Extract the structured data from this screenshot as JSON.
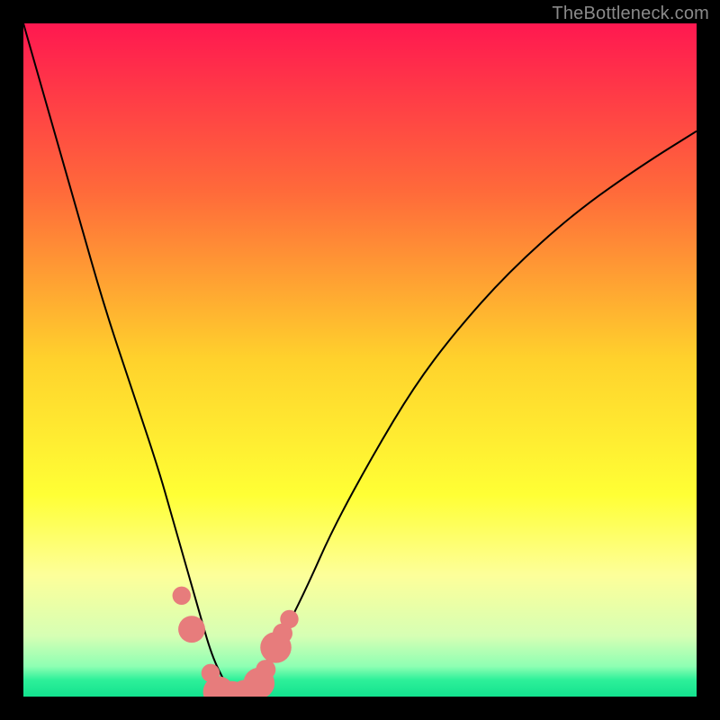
{
  "watermark": {
    "text": "TheBottleneck.com"
  },
  "chart_data": {
    "type": "line",
    "title": "",
    "xlabel": "",
    "ylabel": "",
    "xlim": [
      0,
      100
    ],
    "ylim": [
      0,
      100
    ],
    "grid": false,
    "background_gradient": {
      "stops": [
        {
          "offset": 0.0,
          "color": "#ff1850"
        },
        {
          "offset": 0.25,
          "color": "#ff6a3a"
        },
        {
          "offset": 0.5,
          "color": "#ffd22c"
        },
        {
          "offset": 0.7,
          "color": "#ffff35"
        },
        {
          "offset": 0.82,
          "color": "#fdff9a"
        },
        {
          "offset": 0.91,
          "color": "#d6ffb4"
        },
        {
          "offset": 0.955,
          "color": "#8effb3"
        },
        {
          "offset": 0.975,
          "color": "#2ef09a"
        },
        {
          "offset": 1.0,
          "color": "#13e28e"
        }
      ]
    },
    "series": [
      {
        "name": "bottleneck-curve",
        "color": "#000000",
        "x": [
          0,
          4,
          8,
          12,
          16,
          20,
          22,
          24,
          26,
          28,
          30,
          31,
          32,
          34,
          38,
          42,
          46,
          52,
          58,
          64,
          72,
          82,
          92,
          100
        ],
        "values": [
          100,
          86,
          72,
          58,
          46,
          34,
          27,
          20,
          13,
          6,
          2,
          0,
          0,
          2,
          8,
          16,
          25,
          36,
          46,
          54,
          63,
          72,
          79,
          84
        ]
      }
    ],
    "markers": {
      "name": "highlight-dots",
      "color": "#e77c7c",
      "points": [
        {
          "x": 23.5,
          "y": 15.0,
          "r": 1.3
        },
        {
          "x": 25.0,
          "y": 10.0,
          "r": 1.9
        },
        {
          "x": 27.8,
          "y": 3.5,
          "r": 1.3
        },
        {
          "x": 29.0,
          "y": 0.7,
          "r": 2.2
        },
        {
          "x": 31.0,
          "y": 0.0,
          "r": 2.2
        },
        {
          "x": 33.0,
          "y": 0.2,
          "r": 2.2
        },
        {
          "x": 35.0,
          "y": 2.0,
          "r": 2.2
        },
        {
          "x": 36.0,
          "y": 4.0,
          "r": 1.4
        },
        {
          "x": 37.5,
          "y": 7.3,
          "r": 2.2
        },
        {
          "x": 38.5,
          "y": 9.4,
          "r": 1.4
        },
        {
          "x": 39.5,
          "y": 11.5,
          "r": 1.3
        }
      ]
    }
  }
}
